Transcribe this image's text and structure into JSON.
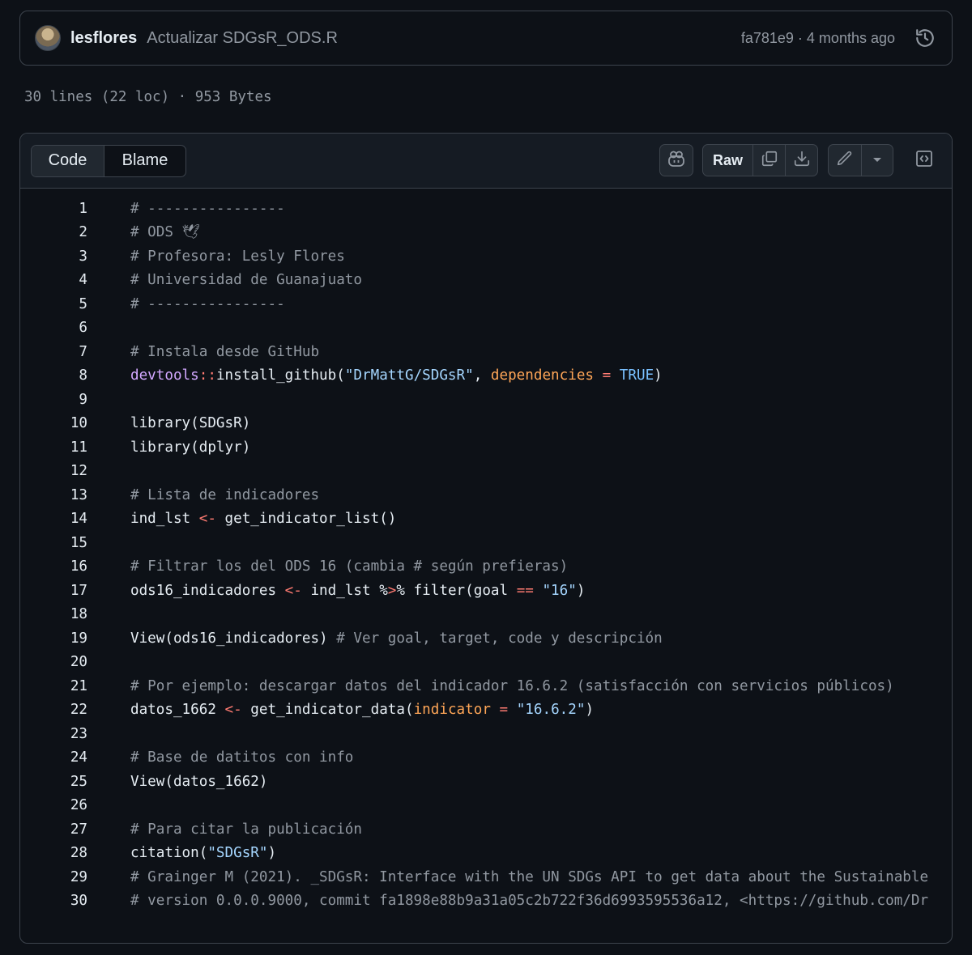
{
  "commit": {
    "author": "lesflores",
    "message": "Actualizar SDGsR_ODS.R",
    "sha_time": "fa781e9 · 4 months ago"
  },
  "file_info": "30 lines (22 loc) · 953 Bytes",
  "toolbar": {
    "tab_code": "Code",
    "tab_blame": "Blame",
    "raw_label": "Raw",
    "icons": [
      "copilot-icon",
      "copy-icon",
      "download-icon",
      "pencil-icon",
      "chevron-down-icon",
      "symbols-panel-icon",
      "history-icon"
    ]
  },
  "colors": {
    "background": "#0d1117",
    "comment": "#9198a1",
    "namespace": "#d2a8ff",
    "operator": "#ff7b72",
    "string": "#a5d6ff",
    "argument": "#ffa657",
    "constant": "#79c0ff"
  },
  "code_lines": [
    [
      [
        "c",
        "# ----------------"
      ]
    ],
    [
      [
        "c",
        "# ODS 🕊"
      ]
    ],
    [
      [
        "c",
        "# Profesora: Lesly Flores"
      ]
    ],
    [
      [
        "c",
        "# Universidad de Guanajuato"
      ]
    ],
    [
      [
        "c",
        "# ----------------"
      ]
    ],
    [],
    [
      [
        "c",
        "# Instala desde GitHub"
      ]
    ],
    [
      [
        "p",
        "devtools"
      ],
      [
        "k",
        "::"
      ],
      [
        "n",
        "install_github("
      ],
      [
        "s",
        "\"DrMattG/SDGsR\""
      ],
      [
        "n",
        ", "
      ],
      [
        "a",
        "dependencies"
      ],
      [
        "n",
        " "
      ],
      [
        "k",
        "="
      ],
      [
        "n",
        " "
      ],
      [
        "b",
        "TRUE"
      ],
      [
        "n",
        ")"
      ]
    ],
    [],
    [
      [
        "n",
        "library(SDGsR)"
      ]
    ],
    [
      [
        "n",
        "library(dplyr)"
      ]
    ],
    [],
    [
      [
        "c",
        "# Lista de indicadores"
      ]
    ],
    [
      [
        "n",
        "ind_lst "
      ],
      [
        "k",
        "<-"
      ],
      [
        "n",
        " get_indicator_list()"
      ]
    ],
    [],
    [
      [
        "c",
        "# Filtrar los del ODS 16 (cambia # según prefieras)"
      ]
    ],
    [
      [
        "n",
        "ods16_indicadores "
      ],
      [
        "k",
        "<-"
      ],
      [
        "n",
        " ind_lst %"
      ],
      [
        "k",
        ">"
      ],
      [
        "n",
        "% filter(goal "
      ],
      [
        "k",
        "=="
      ],
      [
        "n",
        " "
      ],
      [
        "s",
        "\"16\""
      ],
      [
        "n",
        ")"
      ]
    ],
    [],
    [
      [
        "n",
        "View(ods16_indicadores) "
      ],
      [
        "c",
        "# Ver goal, target, code y descripción"
      ]
    ],
    [],
    [
      [
        "c",
        "# Por ejemplo: descargar datos del indicador 16.6.2 (satisfacción con servicios públicos)"
      ]
    ],
    [
      [
        "n",
        "datos_1662 "
      ],
      [
        "k",
        "<-"
      ],
      [
        "n",
        " get_indicator_data("
      ],
      [
        "a",
        "indicator"
      ],
      [
        "n",
        " "
      ],
      [
        "k",
        "="
      ],
      [
        "n",
        " "
      ],
      [
        "s",
        "\"16.6.2\""
      ],
      [
        "n",
        ")"
      ]
    ],
    [],
    [
      [
        "c",
        "# Base de datitos con info"
      ]
    ],
    [
      [
        "n",
        "View(datos_1662)"
      ]
    ],
    [],
    [
      [
        "c",
        "# Para citar la publicación"
      ]
    ],
    [
      [
        "n",
        "citation("
      ],
      [
        "s",
        "\"SDGsR\""
      ],
      [
        "n",
        ")"
      ]
    ],
    [
      [
        "c",
        "# Grainger M (2021). _SDGsR: Interface with the UN SDGs API to get data about the Sustainable"
      ]
    ],
    [
      [
        "c",
        "# version 0.0.0.9000, commit fa1898e88b9a31a05c2b722f36d6993595536a12, <https://github.com/Dr"
      ]
    ]
  ]
}
